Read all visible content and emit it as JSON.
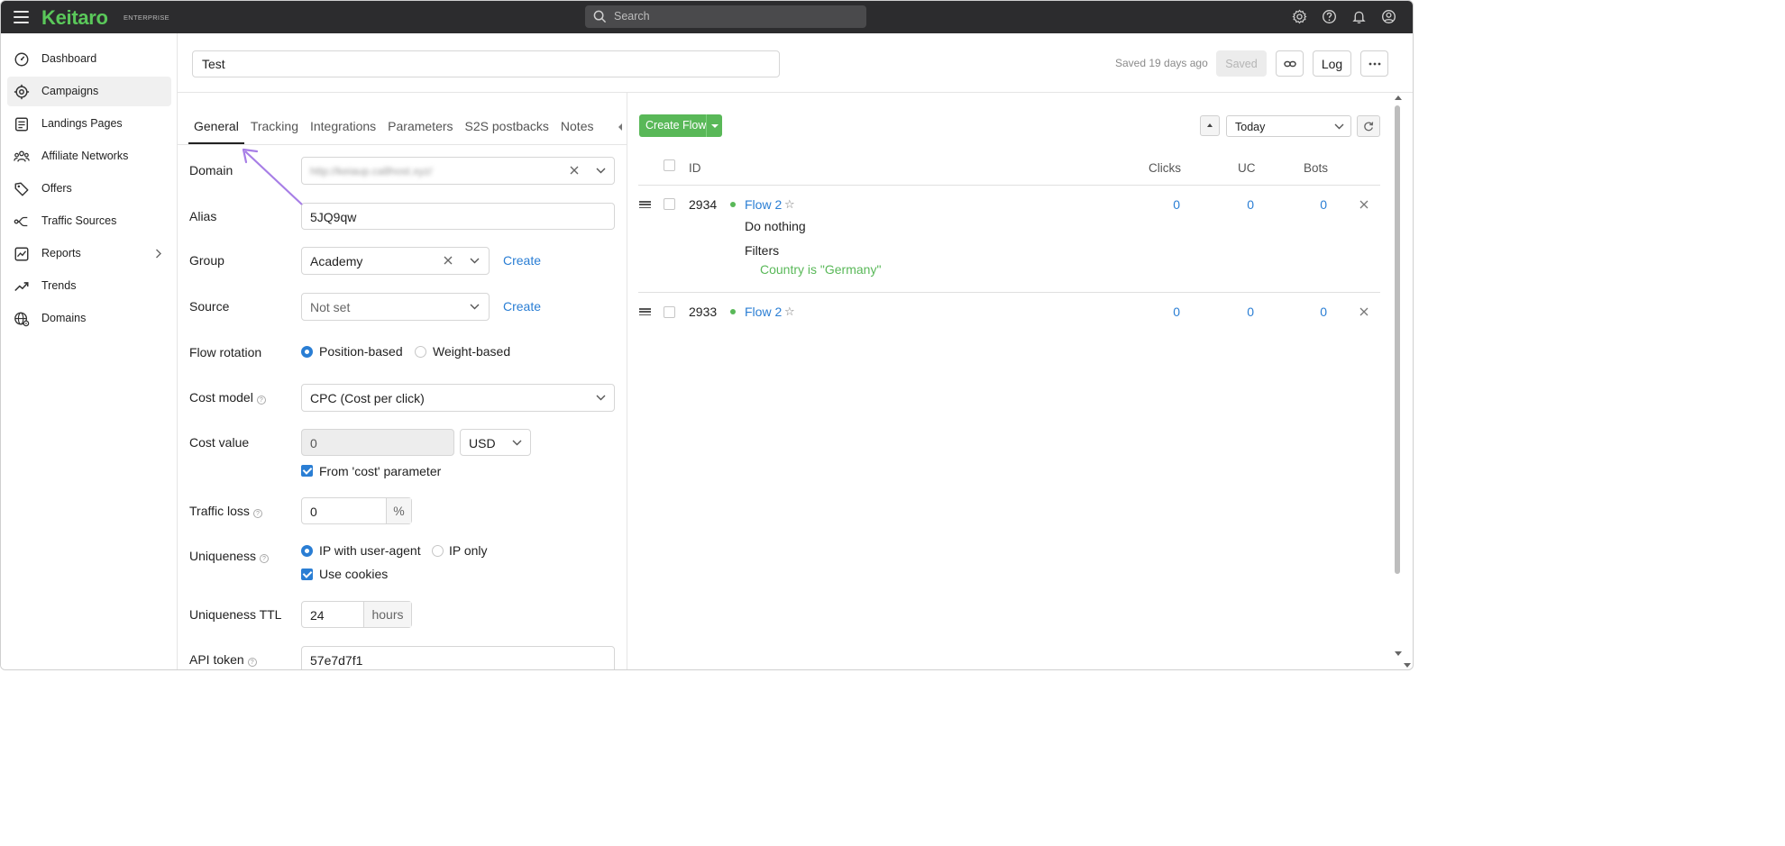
{
  "topbar": {
    "brand": "Keitaro",
    "brand_sub": "ENTERPRISE",
    "search_placeholder": "Search",
    "icons": [
      "gear-icon",
      "help-icon",
      "bell-icon",
      "user-icon"
    ]
  },
  "sidebar": {
    "items": [
      {
        "label": "Dashboard",
        "icon": "dashboard-icon"
      },
      {
        "label": "Campaigns",
        "icon": "campaigns-icon",
        "active": true
      },
      {
        "label": "Landings Pages",
        "icon": "landing-icon"
      },
      {
        "label": "Affiliate Networks",
        "icon": "networks-icon"
      },
      {
        "label": "Offers",
        "icon": "tag-icon"
      },
      {
        "label": "Traffic Sources",
        "icon": "sources-icon"
      },
      {
        "label": "Reports",
        "icon": "reports-icon",
        "expandable": true
      },
      {
        "label": "Trends",
        "icon": "trends-icon"
      },
      {
        "label": "Domains",
        "icon": "domains-icon"
      }
    ]
  },
  "header": {
    "campaign_name": "Test",
    "saved_text": "Saved 19 days ago",
    "saved_button": "Saved",
    "log_button": "Log"
  },
  "tabs": [
    "General",
    "Tracking",
    "Integrations",
    "Parameters",
    "S2S postbacks",
    "Notes"
  ],
  "form": {
    "domain": {
      "label": "Domain",
      "value": "http://keiaup.ca8host.xyz/"
    },
    "alias": {
      "label": "Alias",
      "value": "5JQ9qw"
    },
    "group": {
      "label": "Group",
      "value": "Academy",
      "create": "Create"
    },
    "source": {
      "label": "Source",
      "value": "Not set",
      "create": "Create"
    },
    "flow_rotation": {
      "label": "Flow rotation",
      "options": [
        "Position-based",
        "Weight-based"
      ],
      "selected": "Position-based"
    },
    "cost_model": {
      "label": "Cost model",
      "value": "CPC (Cost per click)"
    },
    "cost_value": {
      "label": "Cost value",
      "value": "0",
      "currency": "USD",
      "from_param": "From 'cost' parameter",
      "from_param_checked": true
    },
    "traffic_loss": {
      "label": "Traffic loss",
      "value": "0",
      "unit": "%"
    },
    "uniqueness": {
      "label": "Uniqueness",
      "options": [
        "IP with user-agent",
        "IP only"
      ],
      "selected": "IP with user-agent",
      "use_cookies": "Use cookies",
      "use_cookies_checked": true
    },
    "uniqueness_ttl": {
      "label": "Uniqueness TTL",
      "value": "24",
      "unit": "hours"
    },
    "api_token": {
      "label": "API token",
      "value": "57e7d7f1"
    }
  },
  "flows": {
    "create_button": "Create Flow",
    "period": "Today",
    "columns": {
      "id": "ID",
      "clicks": "Clicks",
      "uc": "UC",
      "bots": "Bots"
    },
    "rows": [
      {
        "id": "2934",
        "name": "Flow 2",
        "action": "Do nothing",
        "filters_label": "Filters",
        "filter": "Country is \"Germany\"",
        "clicks": "0",
        "uc": "0",
        "bots": "0"
      },
      {
        "id": "2933",
        "name": "Flow 2",
        "clicks": "0",
        "uc": "0",
        "bots": "0"
      }
    ]
  },
  "colors": {
    "accent": "#2a7ed4",
    "brand": "#5ac85a",
    "topbar": "#2c2c2e",
    "annotation": "#a77ee6"
  }
}
